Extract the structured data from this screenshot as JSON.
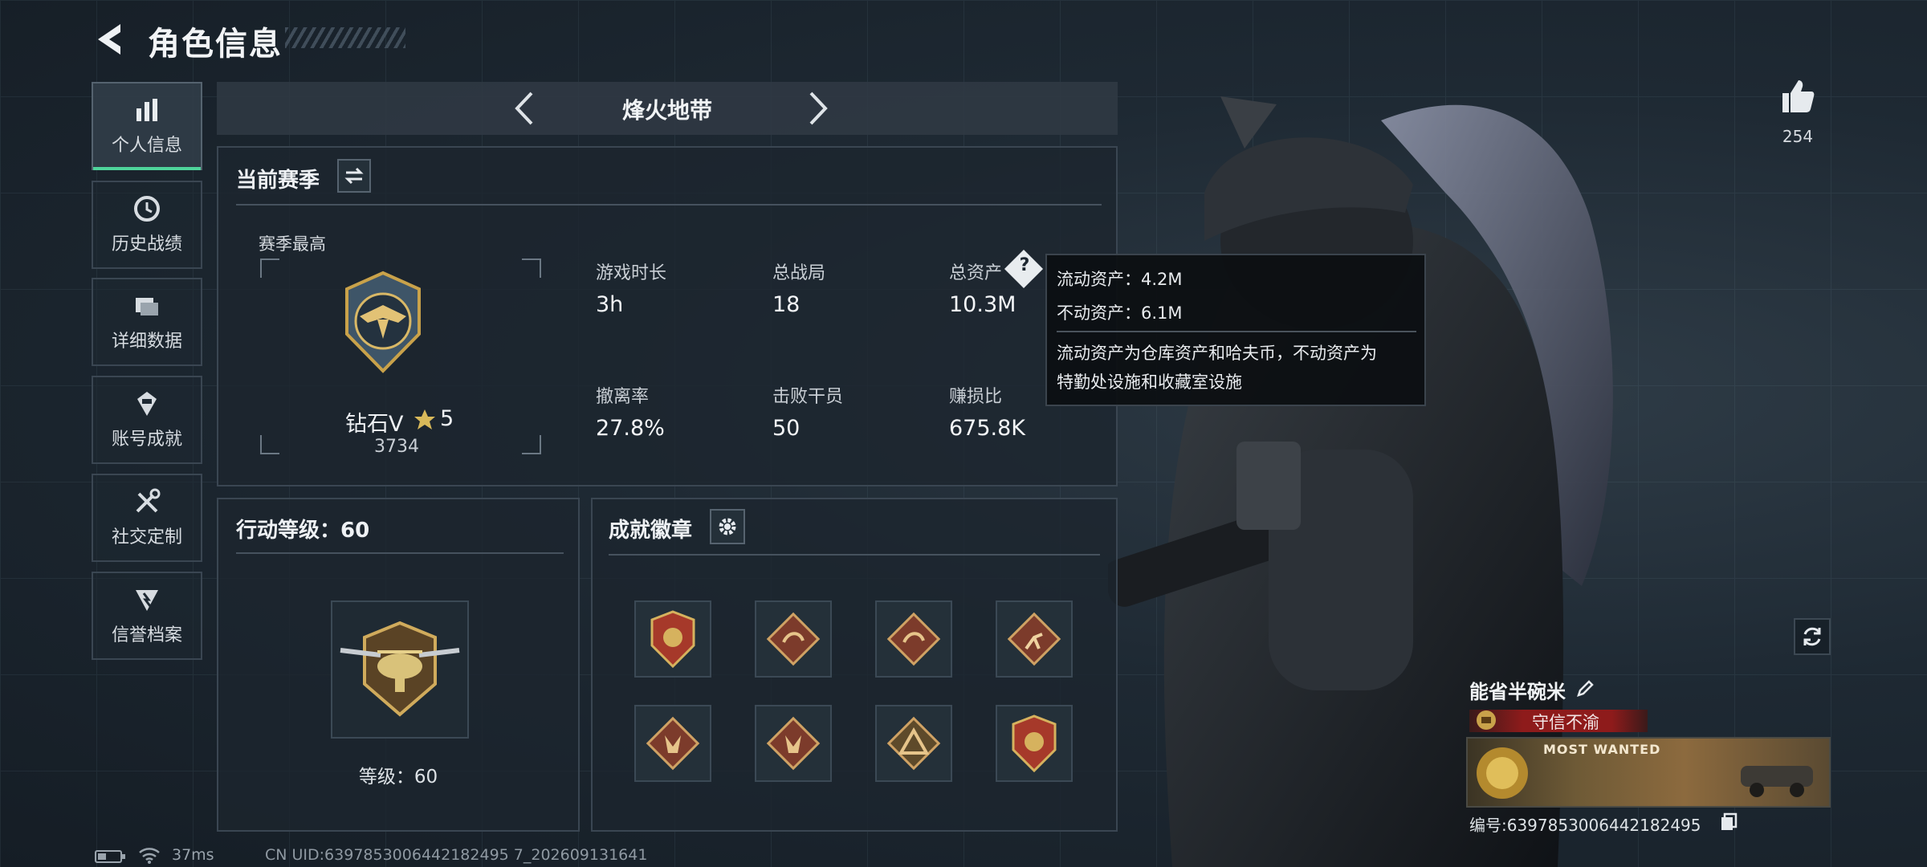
{
  "header": {
    "title": "角色信息"
  },
  "nav": [
    {
      "label": "个人信息",
      "icon": "bar-chart-icon",
      "active": true
    },
    {
      "label": "历史战绩",
      "icon": "history-icon"
    },
    {
      "label": "详细数据",
      "icon": "folders-icon"
    },
    {
      "label": "账号成就",
      "icon": "achievement-icon"
    },
    {
      "label": "社交定制",
      "icon": "tools-icon"
    },
    {
      "label": "信誉档案",
      "icon": "credit-icon"
    }
  ],
  "mode_selector": {
    "label": "烽火地带"
  },
  "season": {
    "title": "当前赛季",
    "peak_label": "赛季最高",
    "rank_name": "钻石V",
    "rank_stars": "5",
    "rank_points": "3734",
    "stats": [
      {
        "label": "游戏时长",
        "value": "3h"
      },
      {
        "label": "总战局",
        "value": "18"
      },
      {
        "label": "总资产",
        "value": "10.3M"
      },
      {
        "label": "撤离率",
        "value": "27.8%"
      },
      {
        "label": "击败干员",
        "value": "50"
      },
      {
        "label": "赚损比",
        "value": "675.8K"
      }
    ]
  },
  "tooltip": {
    "liquid": "流动资产：4.2M",
    "fixed": "不动资产：6.1M",
    "desc_line1": "流动资产为仓库资产和哈夫币，不动资产为",
    "desc_line2": "特勤处设施和收藏室设施"
  },
  "action_level": {
    "title": "行动等级：60",
    "level_text": "等级：60"
  },
  "achievements": {
    "title": "成就徽章"
  },
  "like": {
    "count": "254"
  },
  "player": {
    "name": "能省半碗米",
    "credit_tag": "守信不渝",
    "card_text": "MOST WANTED",
    "id_text": "编号:6397853006442182495"
  },
  "status": {
    "ping": "37ms",
    "uid": "CN UID:6397853006442182495 7_202609131641"
  },
  "colors": {
    "accent": "#4fd49b",
    "credit_red": "#8e1b1b",
    "gold": "#c9a24a"
  }
}
